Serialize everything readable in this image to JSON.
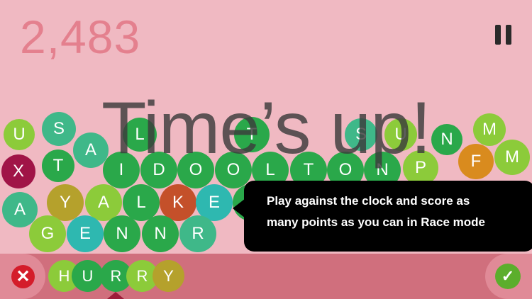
{
  "score": "2,483",
  "banner": "Time’s up!",
  "tooltip": {
    "line1": "Play against the clock and score as",
    "line2": "many points as you can in Race mode"
  },
  "icons": {
    "pause": "pause-icon",
    "cancel": "close-icon",
    "submit": "check-icon"
  },
  "icon_glyphs": {
    "cancel": "✕",
    "submit": "✓"
  },
  "current_word": [
    "H",
    "U",
    "R",
    "R",
    "Y"
  ],
  "colors": {
    "background": "#f0b9c2",
    "score": "#e4808e",
    "bottom_bar": "#d06f7d",
    "cancel": "#d41c2a",
    "submit": "#5cae2c",
    "tooltip": "#000000"
  },
  "bubbles": [
    {
      "letter": "U",
      "color": "#8ccb3a"
    },
    {
      "letter": "S",
      "color": "#3fb889"
    },
    {
      "letter": "A",
      "color": "#3fb889"
    },
    {
      "letter": "L",
      "color": "#2aa84a"
    },
    {
      "letter": "T",
      "color": "#2aa84a"
    },
    {
      "letter": "S",
      "color": "#3fb889"
    },
    {
      "letter": "U",
      "color": "#8ccb3a"
    },
    {
      "letter": "N",
      "color": "#2aa84a"
    },
    {
      "letter": "M",
      "color": "#8ccb3a"
    },
    {
      "letter": "X",
      "color": "#a01447"
    },
    {
      "letter": "T",
      "color": "#2aa84a"
    },
    {
      "letter": "I",
      "color": "#2aa84a"
    },
    {
      "letter": "D",
      "color": "#2aa84a"
    },
    {
      "letter": "O",
      "color": "#2aa84a"
    },
    {
      "letter": "O",
      "color": "#2aa84a"
    },
    {
      "letter": "L",
      "color": "#2aa84a"
    },
    {
      "letter": "T",
      "color": "#2aa84a"
    },
    {
      "letter": "O",
      "color": "#2aa84a"
    },
    {
      "letter": "N",
      "color": "#2aa84a"
    },
    {
      "letter": "P",
      "color": "#8ccb3a"
    },
    {
      "letter": "F",
      "color": "#d98b1e"
    },
    {
      "letter": "M",
      "color": "#8ccb3a"
    },
    {
      "letter": "A",
      "color": "#3fb889"
    },
    {
      "letter": "Y",
      "color": "#b5a12c"
    },
    {
      "letter": "A",
      "color": "#8ccb3a"
    },
    {
      "letter": "L",
      "color": "#2aa84a"
    },
    {
      "letter": "K",
      "color": "#c4502a"
    },
    {
      "letter": "E",
      "color": "#2eb8b0"
    },
    {
      "letter": "L",
      "color": "#2aa84a"
    },
    {
      "letter": "G",
      "color": "#8ccb3a"
    },
    {
      "letter": "E",
      "color": "#2eb8b0"
    },
    {
      "letter": "N",
      "color": "#2aa84a"
    },
    {
      "letter": "N",
      "color": "#2aa84a"
    },
    {
      "letter": "R",
      "color": "#3fb889"
    }
  ],
  "word_colors": [
    "#8ccb3a",
    "#2aa84a",
    "#2aa84a",
    "#8ccb3a",
    "#b5a12c"
  ]
}
